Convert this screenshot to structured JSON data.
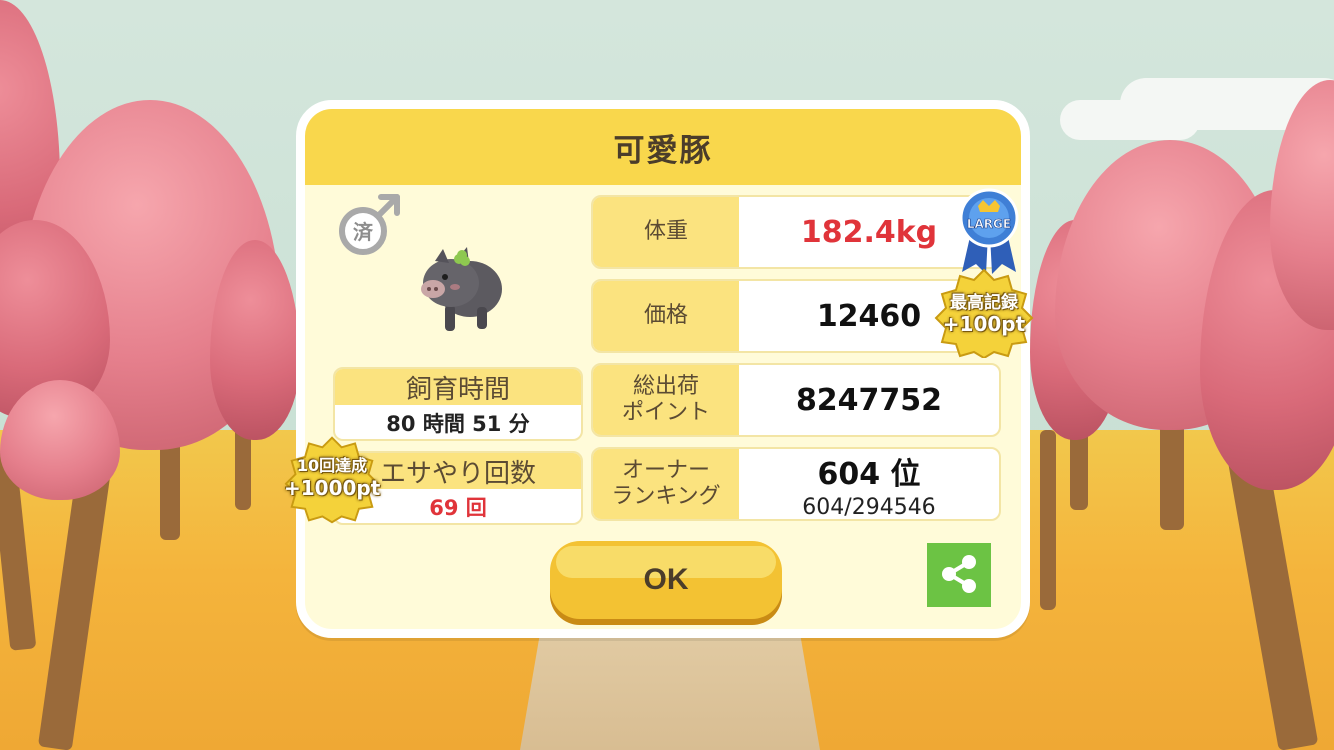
{
  "dialog": {
    "title": "可愛豚",
    "neutered_label": "済",
    "feeding_time": {
      "label": "飼育時間",
      "value": "80 時間 51 分"
    },
    "feed_count": {
      "label": "エサやり回数",
      "value": "69 回"
    },
    "feed_badge": {
      "line1": "10回達成",
      "line2": "+1000pt"
    },
    "stats": [
      {
        "label": "体重",
        "value": "182.4kg"
      },
      {
        "label": "価格",
        "value": "12460"
      },
      {
        "label": "総出荷\nポイント",
        "value": "8247752"
      },
      {
        "label": "オーナー\nランキング",
        "value": "604 位",
        "sub": "604/294546"
      }
    ],
    "large_badge": "LARGE",
    "record_badge": {
      "line1": "最高記録",
      "line2": "+100pt"
    },
    "ok_label": "OK",
    "share_icon": "share-icon"
  },
  "colors": {
    "title_bar": "#f9d74c",
    "label_bg": "#fbe37f",
    "highlight_red": "#e0343a",
    "share_green": "#6cc344",
    "ok_button": "#f3c233"
  }
}
